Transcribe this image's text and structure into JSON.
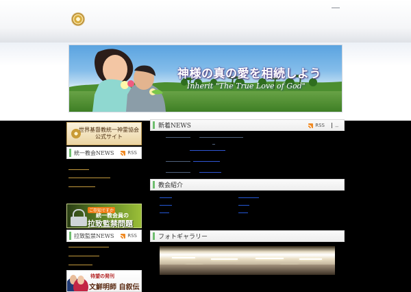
{
  "header": {
    "logo_icon": "gold-seal-icon",
    "top_link_icon": "tiny-dash-icon"
  },
  "banner": {
    "title": "神様の真の愛を相続しよう",
    "subtitle": "Inherit \"The True Love of God\""
  },
  "left": {
    "official_site": {
      "line1": "世界基督教統一神霊協会",
      "line2": "公式サイト"
    },
    "sections": [
      {
        "title": "統一教会NEWS",
        "rss": "RSS"
      },
      {
        "title": "拉致監禁NEWS",
        "rss": "RSS"
      }
    ],
    "ad": {
      "small": "ご存知ですか",
      "line1": "統一教会員の",
      "line2": "拉致監禁問題"
    },
    "book": {
      "tag": "待望の発刊",
      "title": "文鮮明師 自叙伝"
    }
  },
  "right": {
    "news_title": "新着NEWS",
    "rss": "RSS",
    "close": "_",
    "intro_title": "教会紹介",
    "photo_title": "フォトギャラリー"
  },
  "colors": {
    "accent_green": "#6fbe6f",
    "link_blue": "#2f56d5",
    "rss_orange": "#f08a23"
  }
}
